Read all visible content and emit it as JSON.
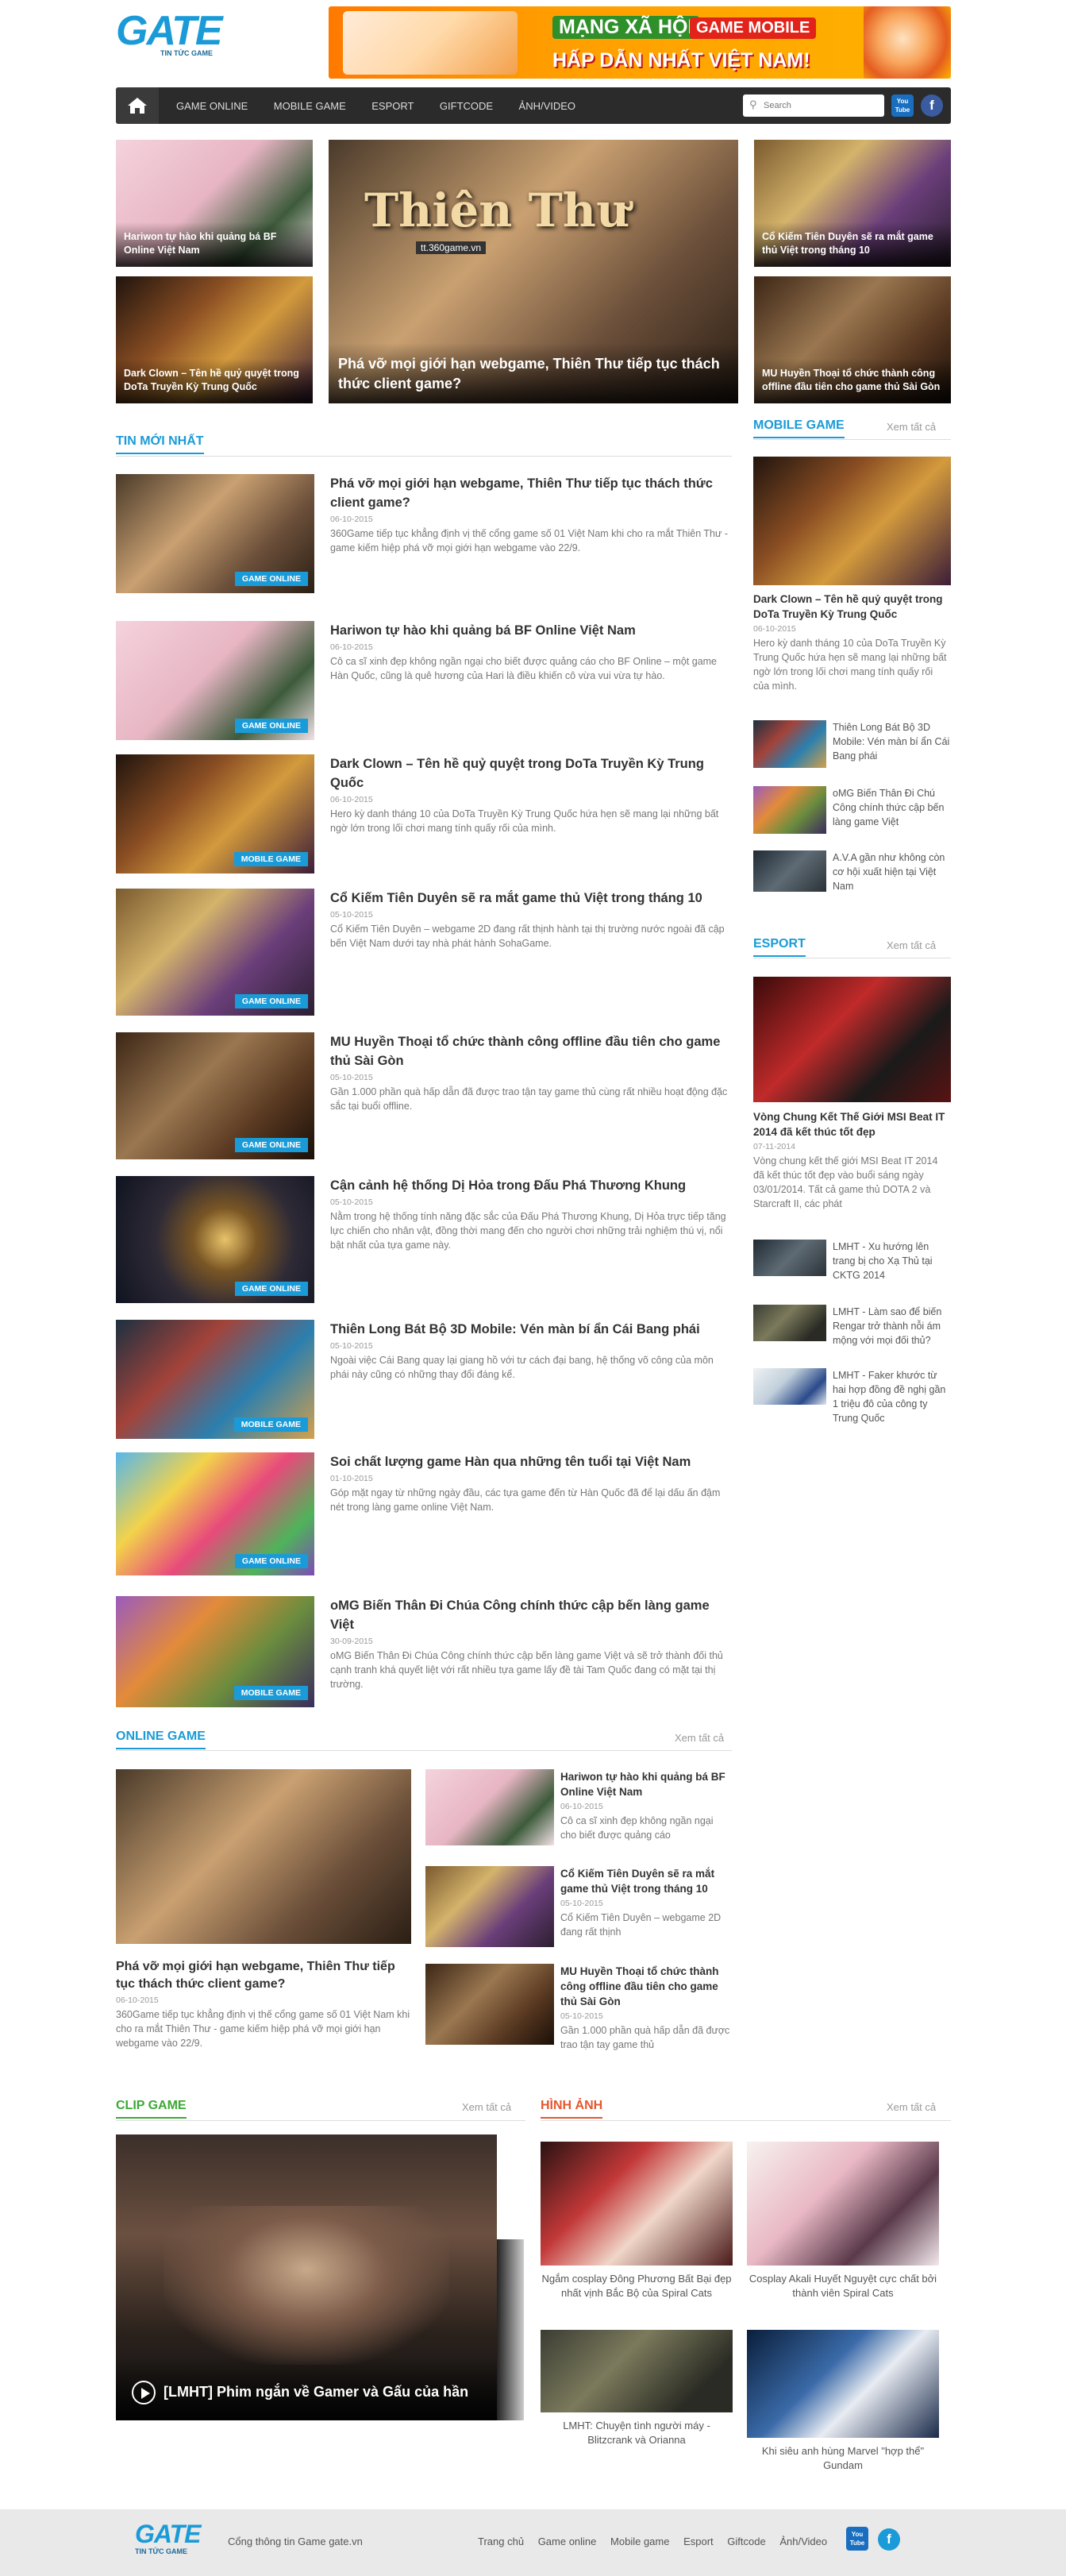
{
  "header": {
    "logo": "GATE",
    "logo_sub": "TIN TỨC GAME",
    "banner_line1": "MẠNG XÃ HỘI",
    "banner_tag": "GAME MOBILE",
    "banner_line2": "HẤP DẪN NHẤT VIỆT NAM!"
  },
  "nav": {
    "items": [
      "GAME ONLINE",
      "MOBILE GAME",
      "ESPORT",
      "GIFTCODE",
      "ẢNH/VIDEO"
    ],
    "search_placeholder": "Search",
    "youtube": "You Tube",
    "facebook": "f"
  },
  "hero": {
    "left": [
      {
        "title": "Hariwon tự hào khi quảng bá BF Online Việt Nam"
      },
      {
        "title": "Dark Clown – Tên hề quỷ quyệt trong DoTa Truyền Kỳ Trung Quốc"
      }
    ],
    "main": {
      "title": "Phá vỡ mọi giới hạn webgame, Thiên Thư tiếp tục thách thức client game?",
      "overlay": "Thiên Thư",
      "overlay_url": "tt.360game.vn"
    },
    "right": [
      {
        "title": "Cổ Kiếm Tiên Duyên sẽ ra mắt game thủ Việt trong tháng 10"
      },
      {
        "title": "MU Huyền Thoại tổ chức thành công offline đầu tiên cho game thủ Sài Gòn"
      }
    ]
  },
  "latest": {
    "heading": "TIN MỚI NHẤT",
    "items": [
      {
        "title": "Phá vỡ mọi giới hạn webgame, Thiên Thư tiếp tục thách thức client game?",
        "date": "06-10-2015",
        "summary": "360Game tiếp tục khẳng định vị thế cổng game số 01 Việt Nam khi cho ra mắt Thiên Thư - game kiếm hiệp phá vỡ mọi giới hạn webgame vào 22/9.",
        "badge": "GAME ONLINE"
      },
      {
        "title": "Hariwon tự hào khi quảng bá BF Online Việt Nam",
        "date": "06-10-2015",
        "summary": "Cô ca sĩ xinh đẹp không ngần ngại cho biết được quảng cáo cho BF Online – một game Hàn Quốc, cũng là quê hương của Hari là điều khiến cô vừa vui vừa tự hào.",
        "badge": "GAME ONLINE"
      },
      {
        "title": "Dark Clown – Tên hề quỷ quyệt trong DoTa Truyền Kỳ Trung Quốc",
        "date": "06-10-2015",
        "summary": "Hero kỳ danh tháng 10 của DoTa Truyền Kỳ Trung Quốc hứa hẹn sẽ mang lại những bất ngờ lớn trong lối chơi mang tính quấy rối của mình.",
        "badge": "MOBILE GAME"
      },
      {
        "title": "Cổ Kiếm Tiên Duyên sẽ ra mắt game thủ Việt trong tháng 10",
        "date": "05-10-2015",
        "summary": "Cổ Kiếm Tiên Duyên – webgame 2D đang rất thịnh hành tại thị trường nước ngoài đã cập bến Việt Nam dưới tay nhà phát hành SohaGame.",
        "badge": "GAME ONLINE"
      },
      {
        "title": "MU Huyền Thoại tổ chức thành công offline đầu tiên cho game thủ Sài Gòn",
        "date": "05-10-2015",
        "summary": "Gần 1.000 phần quà hấp dẫn đã được trao tận tay game thủ cùng rất nhiều hoạt động đặc sắc tại buổi offline.",
        "badge": "GAME ONLINE"
      },
      {
        "title": "Cận cảnh hệ thống Dị Hỏa trong Đấu Phá Thương Khung",
        "date": "05-10-2015",
        "summary": "Nằm trong hệ thống tính năng đặc sắc của Đấu Phá Thương Khung, Dị Hỏa trực tiếp tăng lực chiến cho nhân vật, đồng thời mang đến cho người chơi những trải nghiệm thú vị, nổi bật nhất của tựa game này.",
        "badge": "GAME ONLINE"
      },
      {
        "title": "Thiên Long Bát Bộ 3D Mobile: Vén màn bí ẩn Cái Bang phái",
        "date": "05-10-2015",
        "summary": "Ngoài việc Cái Bang quay lại giang hồ với tư cách đại bang, hệ thống võ công của môn phái này cũng có những thay đổi đáng kể.",
        "badge": "MOBILE GAME"
      },
      {
        "title": "Soi chất lượng game Hàn qua những tên tuổi tại Việt Nam",
        "date": "01-10-2015",
        "summary": "Góp mặt ngay từ những ngày đầu, các tựa game đến từ Hàn Quốc đã để lại dấu ấn đậm nét trong làng game online Việt Nam.",
        "badge": "GAME ONLINE"
      },
      {
        "title": "oMG Biến Thân Đi Chúa Công chính thức cập bến làng game Việt",
        "date": "30-09-2015",
        "summary": "oMG Biến Thân Đi Chúa Công chính thức cập bến làng game Việt và sẽ trở thành đối thủ cạnh tranh khá quyết liệt với rất nhiều tựa game lấy đề tài Tam Quốc đang có mặt tại thị trường.",
        "badge": "MOBILE GAME"
      }
    ]
  },
  "mobile_game": {
    "heading": "MOBILE GAME",
    "see_all": "Xem tất cả",
    "featured": {
      "title": "Dark Clown – Tên hề quỷ quyệt trong DoTa Truyền Kỳ Trung Quốc",
      "date": "06-10-2015",
      "summary": "Hero kỳ danh tháng 10 của DoTa Truyền Kỳ Trung Quốc hứa hẹn sẽ mang lại những bất ngờ lớn trong lối chơi mang tính quấy rối của mình."
    },
    "list": [
      "Thiên Long Bát Bộ 3D Mobile: Vén màn bí ẩn Cái Bang phái",
      "oMG Biến Thân Đi Chú Công chính thức cập bến làng game Việt",
      "A.V.A gần như không còn cơ hội xuất hiện tại Việt Nam"
    ]
  },
  "esport": {
    "heading": "ESPORT",
    "see_all": "Xem tất cả",
    "featured": {
      "title": "Vòng Chung Kết Thế Giới MSI Beat IT 2014 đã kết thúc tốt đẹp",
      "date": "07-11-2014",
      "summary": "Vòng chung kết thế giới MSI Beat IT 2014 đã kết thúc tốt đẹp vào buổi sáng ngày 03/01/2014. Tất cả game thủ DOTA 2 và Starcraft II, các phát"
    },
    "list": [
      "LMHT - Xu hướng lên trang bị cho Xạ Thủ tại CKTG 2014",
      "LMHT - Làm sao để biến Rengar trở thành nỗi ám mộng với mọi đối thủ?",
      "LMHT - Faker khước từ hai hợp đồng đề nghị gần 1 triệu đô của công ty Trung Quốc"
    ]
  },
  "online_game": {
    "heading": "ONLINE GAME",
    "see_all": "Xem tất cả",
    "featured": {
      "title": "Phá vỡ mọi giới hạn webgame, Thiên Thư tiếp tục thách thức client game?",
      "date": "06-10-2015",
      "summary": "360Game tiếp tục khẳng định vị thế cổng game số 01 Việt Nam khi cho ra mắt Thiên Thư - game kiếm hiệp phá vỡ mọi giới hạn webgame vào 22/9."
    },
    "list": [
      {
        "title": "Hariwon tự hào khi quảng bá BF Online Việt Nam",
        "date": "06-10-2015",
        "summary": "Cô ca sĩ xinh đẹp không ngần ngại cho biết được quảng cáo"
      },
      {
        "title": "Cổ Kiếm Tiên Duyên sẽ ra mắt game thủ Việt trong tháng 10",
        "date": "05-10-2015",
        "summary": "Cổ Kiếm Tiên Duyên – webgame 2D đang rất thịnh"
      },
      {
        "title": "MU Huyền Thoại tổ chức thành công offline đầu tiên cho game thủ Sài Gòn",
        "date": "05-10-2015",
        "summary": "Gần 1.000 phần quà hấp dẫn đã được trao tận tay game thủ"
      }
    ]
  },
  "clip": {
    "heading": "CLIP GAME",
    "see_all": "Xem tất cả",
    "video_title": "[LMHT] Phim ngắn về Gamer và Gấu của hần"
  },
  "photos": {
    "heading": "HÌNH ẢNH",
    "see_all": "Xem tất cả",
    "items": [
      "Ngắm cosplay Đông Phương Bất Bại đẹp nhất vịnh Bắc Bộ của Spiral Cats",
      "Cosplay Akali Huyết Nguyệt cực chất bởi thành viên Spiral Cats",
      "LMHT: Chuyện tình người máy - Blitzcrank và Orianna",
      "Khi siêu anh hùng Marvel \"hợp thể\" Gundam"
    ]
  },
  "footer": {
    "logo": "GATE",
    "logo_sub": "TIN TỨC GAME",
    "tagline": "Cổng thông tin Game gate.vn",
    "links": [
      "Trang chủ",
      "Game online",
      "Mobile game",
      "Esport",
      "Giftcode",
      "Ảnh/Video"
    ],
    "youtube": "You Tube",
    "facebook": "f"
  },
  "colors": {
    "accent": "#1a9bd7",
    "clip": "#3aaa35",
    "photo": "#e4572e",
    "nav": "#2b2b2b",
    "footer": "#e9e9e9"
  }
}
